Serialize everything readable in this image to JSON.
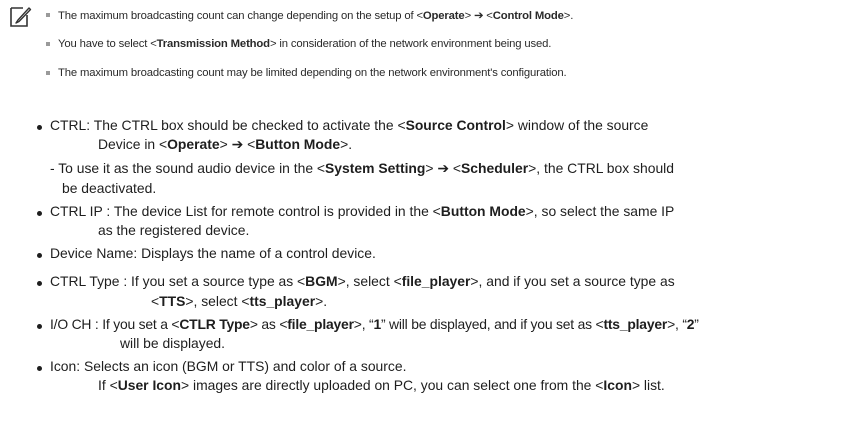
{
  "notes": [
    {
      "pre": "The maximum broadcasting count can change depending on the setup of <",
      "b1": "Operate",
      "mid": "> ➔ <",
      "b2": "Control Mode",
      "post": ">."
    },
    {
      "pre": "You have to select <",
      "b1": "Transmission Method",
      "post": "> in consideration of the network environment being used."
    },
    {
      "text": "The maximum broadcasting count may be limited depending on the network environment's configuration."
    }
  ],
  "items": {
    "ctrl": {
      "l1_pre": "CTRL: The CTRL box should be checked to activate the <",
      "l1_b": "Source Control",
      "l1_post": "> window of the source",
      "l2_pre": "Device in <",
      "l2_b1": "Operate",
      "l2_mid": "> ➔ <",
      "l2_b2": "Button Mode",
      "l2_post": ">."
    },
    "ctrl_sub": {
      "l1_pre": "- To use it as the sound audio device in the <",
      "l1_b1": "System Setting",
      "l1_mid": "> ➔ <",
      "l1_b2": "Scheduler",
      "l1_post": ">, the CTRL box should",
      "l2": "be deactivated."
    },
    "ctrl_ip": {
      "l1_pre": "CTRL IP : The device List for remote control is provided in the <",
      "l1_b": "Button Mode",
      "l1_post": ">, so select the same IP",
      "l2": "as the registered device."
    },
    "device_name": {
      "text": "Device Name: Displays the name of a control device."
    },
    "ctrl_type": {
      "l1_pre": "CTRL Type : If you set a source type as <",
      "l1_b1": "BGM",
      "l1_mid": ">, select <",
      "l1_b2": "file_player",
      "l1_post": ">, and if you set a source type as",
      "l2_pre": "<",
      "l2_b1": "TTS",
      "l2_mid": ">, select <",
      "l2_b2": "tts_player",
      "l2_post": ">."
    },
    "io_ch": {
      "l1_a": "I/O CH : If you set a <",
      "l1_b1": "CTLR Type",
      "l1_c": "> as <",
      "l1_b2": "file_player",
      "l1_d": ">, “",
      "l1_b3": "1",
      "l1_e": "” will be displayed, and if you set as <",
      "l1_b4": "tts_player",
      "l1_f": ">, “",
      "l1_b5": "2",
      "l1_g": "”",
      "l2": "will be displayed."
    },
    "icon": {
      "l1": "Icon: Selects an icon (BGM or TTS) and color of a source.",
      "l2_pre": "If <",
      "l2_b1": "User Icon",
      "l2_mid": "> images are directly uploaded on PC, you can select one from the <",
      "l2_b2": "Icon",
      "l2_post": "> list."
    }
  }
}
